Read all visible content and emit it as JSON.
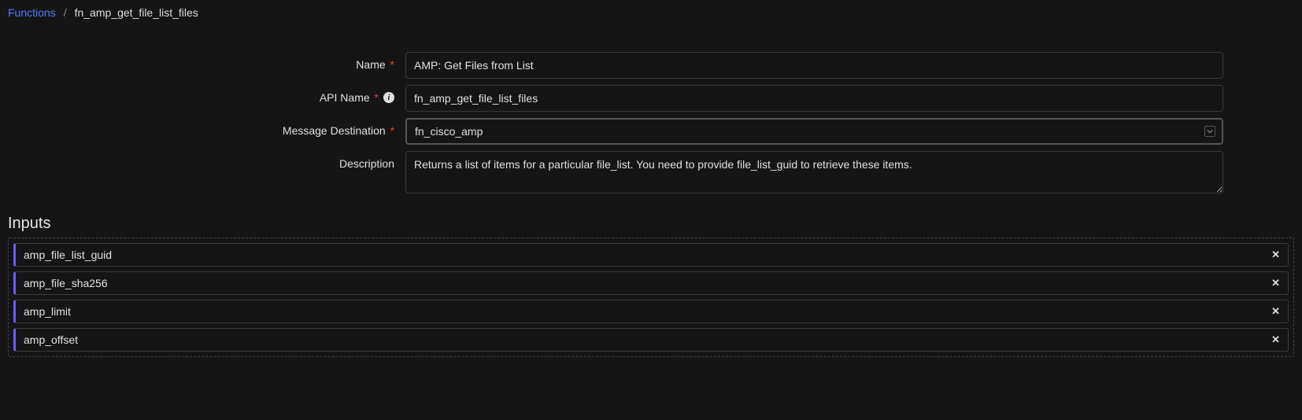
{
  "breadcrumb": {
    "root": "Functions",
    "current": "fn_amp_get_file_list_files"
  },
  "form": {
    "labels": {
      "name": "Name",
      "api_name": "API Name",
      "message_destination": "Message Destination",
      "description": "Description"
    },
    "name_value": "AMP: Get Files from List",
    "api_name_value": "fn_amp_get_file_list_files",
    "message_destination_value": "fn_cisco_amp",
    "description_value": "Returns a list of items for a particular file_list. You need to provide file_list_guid to retrieve these items."
  },
  "inputs": {
    "title": "Inputs",
    "items": [
      "amp_file_list_guid",
      "amp_file_sha256",
      "amp_limit",
      "amp_offset"
    ]
  }
}
